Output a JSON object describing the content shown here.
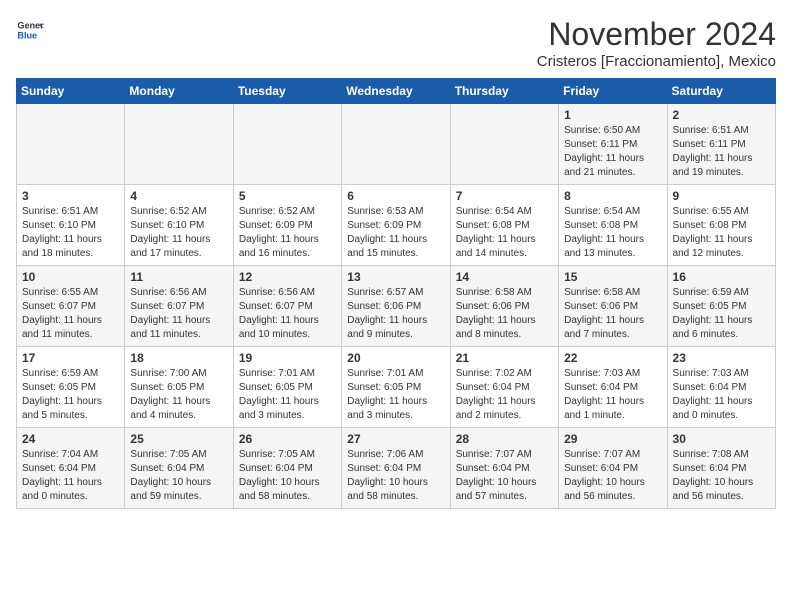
{
  "header": {
    "logo_line1": "General",
    "logo_line2": "Blue",
    "month": "November 2024",
    "location": "Cristeros [Fraccionamiento], Mexico"
  },
  "weekdays": [
    "Sunday",
    "Monday",
    "Tuesday",
    "Wednesday",
    "Thursday",
    "Friday",
    "Saturday"
  ],
  "weeks": [
    [
      {
        "day": "",
        "info": ""
      },
      {
        "day": "",
        "info": ""
      },
      {
        "day": "",
        "info": ""
      },
      {
        "day": "",
        "info": ""
      },
      {
        "day": "",
        "info": ""
      },
      {
        "day": "1",
        "info": "Sunrise: 6:50 AM\nSunset: 6:11 PM\nDaylight: 11 hours\nand 21 minutes."
      },
      {
        "day": "2",
        "info": "Sunrise: 6:51 AM\nSunset: 6:11 PM\nDaylight: 11 hours\nand 19 minutes."
      }
    ],
    [
      {
        "day": "3",
        "info": "Sunrise: 6:51 AM\nSunset: 6:10 PM\nDaylight: 11 hours\nand 18 minutes."
      },
      {
        "day": "4",
        "info": "Sunrise: 6:52 AM\nSunset: 6:10 PM\nDaylight: 11 hours\nand 17 minutes."
      },
      {
        "day": "5",
        "info": "Sunrise: 6:52 AM\nSunset: 6:09 PM\nDaylight: 11 hours\nand 16 minutes."
      },
      {
        "day": "6",
        "info": "Sunrise: 6:53 AM\nSunset: 6:09 PM\nDaylight: 11 hours\nand 15 minutes."
      },
      {
        "day": "7",
        "info": "Sunrise: 6:54 AM\nSunset: 6:08 PM\nDaylight: 11 hours\nand 14 minutes."
      },
      {
        "day": "8",
        "info": "Sunrise: 6:54 AM\nSunset: 6:08 PM\nDaylight: 11 hours\nand 13 minutes."
      },
      {
        "day": "9",
        "info": "Sunrise: 6:55 AM\nSunset: 6:08 PM\nDaylight: 11 hours\nand 12 minutes."
      }
    ],
    [
      {
        "day": "10",
        "info": "Sunrise: 6:55 AM\nSunset: 6:07 PM\nDaylight: 11 hours\nand 11 minutes."
      },
      {
        "day": "11",
        "info": "Sunrise: 6:56 AM\nSunset: 6:07 PM\nDaylight: 11 hours\nand 11 minutes."
      },
      {
        "day": "12",
        "info": "Sunrise: 6:56 AM\nSunset: 6:07 PM\nDaylight: 11 hours\nand 10 minutes."
      },
      {
        "day": "13",
        "info": "Sunrise: 6:57 AM\nSunset: 6:06 PM\nDaylight: 11 hours\nand 9 minutes."
      },
      {
        "day": "14",
        "info": "Sunrise: 6:58 AM\nSunset: 6:06 PM\nDaylight: 11 hours\nand 8 minutes."
      },
      {
        "day": "15",
        "info": "Sunrise: 6:58 AM\nSunset: 6:06 PM\nDaylight: 11 hours\nand 7 minutes."
      },
      {
        "day": "16",
        "info": "Sunrise: 6:59 AM\nSunset: 6:05 PM\nDaylight: 11 hours\nand 6 minutes."
      }
    ],
    [
      {
        "day": "17",
        "info": "Sunrise: 6:59 AM\nSunset: 6:05 PM\nDaylight: 11 hours\nand 5 minutes."
      },
      {
        "day": "18",
        "info": "Sunrise: 7:00 AM\nSunset: 6:05 PM\nDaylight: 11 hours\nand 4 minutes."
      },
      {
        "day": "19",
        "info": "Sunrise: 7:01 AM\nSunset: 6:05 PM\nDaylight: 11 hours\nand 3 minutes."
      },
      {
        "day": "20",
        "info": "Sunrise: 7:01 AM\nSunset: 6:05 PM\nDaylight: 11 hours\nand 3 minutes."
      },
      {
        "day": "21",
        "info": "Sunrise: 7:02 AM\nSunset: 6:04 PM\nDaylight: 11 hours\nand 2 minutes."
      },
      {
        "day": "22",
        "info": "Sunrise: 7:03 AM\nSunset: 6:04 PM\nDaylight: 11 hours\nand 1 minute."
      },
      {
        "day": "23",
        "info": "Sunrise: 7:03 AM\nSunset: 6:04 PM\nDaylight: 11 hours\nand 0 minutes."
      }
    ],
    [
      {
        "day": "24",
        "info": "Sunrise: 7:04 AM\nSunset: 6:04 PM\nDaylight: 11 hours\nand 0 minutes."
      },
      {
        "day": "25",
        "info": "Sunrise: 7:05 AM\nSunset: 6:04 PM\nDaylight: 10 hours\nand 59 minutes."
      },
      {
        "day": "26",
        "info": "Sunrise: 7:05 AM\nSunset: 6:04 PM\nDaylight: 10 hours\nand 58 minutes."
      },
      {
        "day": "27",
        "info": "Sunrise: 7:06 AM\nSunset: 6:04 PM\nDaylight: 10 hours\nand 58 minutes."
      },
      {
        "day": "28",
        "info": "Sunrise: 7:07 AM\nSunset: 6:04 PM\nDaylight: 10 hours\nand 57 minutes."
      },
      {
        "day": "29",
        "info": "Sunrise: 7:07 AM\nSunset: 6:04 PM\nDaylight: 10 hours\nand 56 minutes."
      },
      {
        "day": "30",
        "info": "Sunrise: 7:08 AM\nSunset: 6:04 PM\nDaylight: 10 hours\nand 56 minutes."
      }
    ]
  ]
}
